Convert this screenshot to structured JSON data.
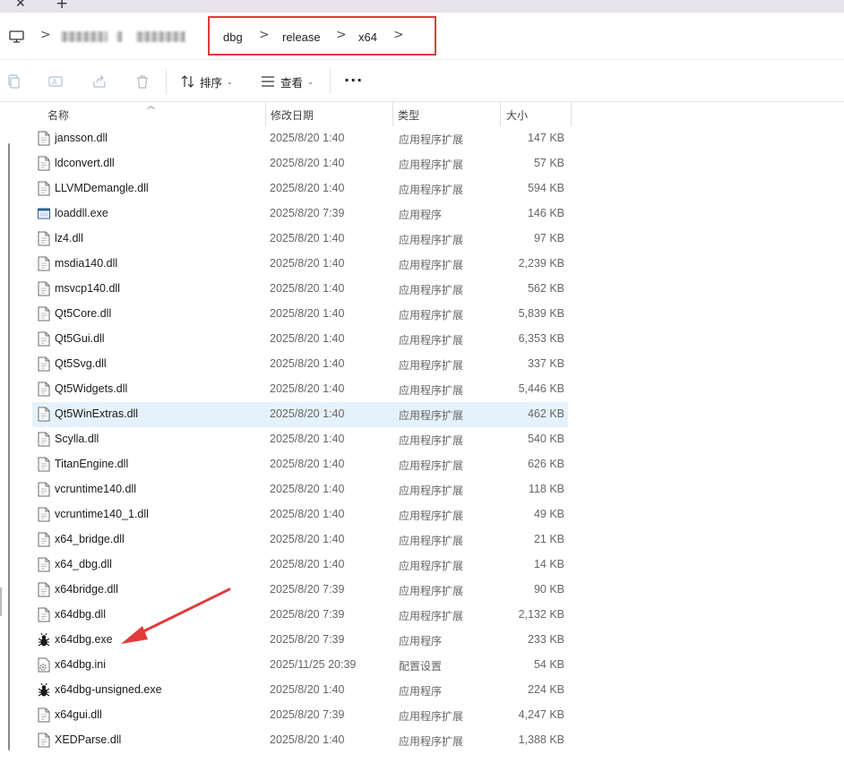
{
  "tabs": {
    "close_glyph": "✕",
    "new_glyph": "+"
  },
  "breadcrumb": {
    "segments": [
      "dbg",
      "release",
      "x64"
    ],
    "separator": ">",
    "highlight_color": "#e23a3a"
  },
  "toolbar": {
    "sort_label": "排序",
    "view_label": "查看",
    "more_label": "···",
    "icons": [
      "copy-icon",
      "rename-icon",
      "share-icon",
      "delete-icon",
      "sort-icon",
      "view-icon"
    ]
  },
  "columns": {
    "name": "名称",
    "date": "修改日期",
    "type": "类型",
    "size": "大小"
  },
  "files": [
    {
      "name": "jansson.dll",
      "date": "2025/8/20 1:40",
      "type": "应用程序扩展",
      "size": "147 KB",
      "icon": "dll"
    },
    {
      "name": "ldconvert.dll",
      "date": "2025/8/20 1:40",
      "type": "应用程序扩展",
      "size": "57 KB",
      "icon": "dll"
    },
    {
      "name": "LLVMDemangle.dll",
      "date": "2025/8/20 1:40",
      "type": "应用程序扩展",
      "size": "594 KB",
      "icon": "dll"
    },
    {
      "name": "loaddll.exe",
      "date": "2025/8/20 7:39",
      "type": "应用程序",
      "size": "146 KB",
      "icon": "exe"
    },
    {
      "name": "lz4.dll",
      "date": "2025/8/20 1:40",
      "type": "应用程序扩展",
      "size": "97 KB",
      "icon": "dll"
    },
    {
      "name": "msdia140.dll",
      "date": "2025/8/20 1:40",
      "type": "应用程序扩展",
      "size": "2,239 KB",
      "icon": "dll"
    },
    {
      "name": "msvcp140.dll",
      "date": "2025/8/20 1:40",
      "type": "应用程序扩展",
      "size": "562 KB",
      "icon": "dll"
    },
    {
      "name": "Qt5Core.dll",
      "date": "2025/8/20 1:40",
      "type": "应用程序扩展",
      "size": "5,839 KB",
      "icon": "dll"
    },
    {
      "name": "Qt5Gui.dll",
      "date": "2025/8/20 1:40",
      "type": "应用程序扩展",
      "size": "6,353 KB",
      "icon": "dll"
    },
    {
      "name": "Qt5Svg.dll",
      "date": "2025/8/20 1:40",
      "type": "应用程序扩展",
      "size": "337 KB",
      "icon": "dll"
    },
    {
      "name": "Qt5Widgets.dll",
      "date": "2025/8/20 1:40",
      "type": "应用程序扩展",
      "size": "5,446 KB",
      "icon": "dll"
    },
    {
      "name": "Qt5WinExtras.dll",
      "date": "2025/8/20 1:40",
      "type": "应用程序扩展",
      "size": "462 KB",
      "icon": "dll",
      "selected": true
    },
    {
      "name": "Scylla.dll",
      "date": "2025/8/20 1:40",
      "type": "应用程序扩展",
      "size": "540 KB",
      "icon": "dll"
    },
    {
      "name": "TitanEngine.dll",
      "date": "2025/8/20 1:40",
      "type": "应用程序扩展",
      "size": "626 KB",
      "icon": "dll"
    },
    {
      "name": "vcruntime140.dll",
      "date": "2025/8/20 1:40",
      "type": "应用程序扩展",
      "size": "118 KB",
      "icon": "dll"
    },
    {
      "name": "vcruntime140_1.dll",
      "date": "2025/8/20 1:40",
      "type": "应用程序扩展",
      "size": "49 KB",
      "icon": "dll"
    },
    {
      "name": "x64_bridge.dll",
      "date": "2025/8/20 1:40",
      "type": "应用程序扩展",
      "size": "21 KB",
      "icon": "dll"
    },
    {
      "name": "x64_dbg.dll",
      "date": "2025/8/20 1:40",
      "type": "应用程序扩展",
      "size": "14 KB",
      "icon": "dll"
    },
    {
      "name": "x64bridge.dll",
      "date": "2025/8/20 7:39",
      "type": "应用程序扩展",
      "size": "90 KB",
      "icon": "dll"
    },
    {
      "name": "x64dbg.dll",
      "date": "2025/8/20 7:39",
      "type": "应用程序扩展",
      "size": "2,132 KB",
      "icon": "dll"
    },
    {
      "name": "x64dbg.exe",
      "date": "2025/8/20 7:39",
      "type": "应用程序",
      "size": "233 KB",
      "icon": "bug"
    },
    {
      "name": "x64dbg.ini",
      "date": "2025/11/25 20:39",
      "type": "配置设置",
      "size": "54 KB",
      "icon": "ini"
    },
    {
      "name": "x64dbg-unsigned.exe",
      "date": "2025/8/20 1:40",
      "type": "应用程序",
      "size": "224 KB",
      "icon": "bug"
    },
    {
      "name": "x64gui.dll",
      "date": "2025/8/20 7:39",
      "type": "应用程序扩展",
      "size": "4,247 KB",
      "icon": "dll"
    },
    {
      "name": "XEDParse.dll",
      "date": "2025/8/20 1:40",
      "type": "应用程序扩展",
      "size": "1,388 KB",
      "icon": "dll"
    }
  ],
  "colors": {
    "selected_row": "#e5f1fb",
    "annotation_arrow": "#e23a3a"
  }
}
